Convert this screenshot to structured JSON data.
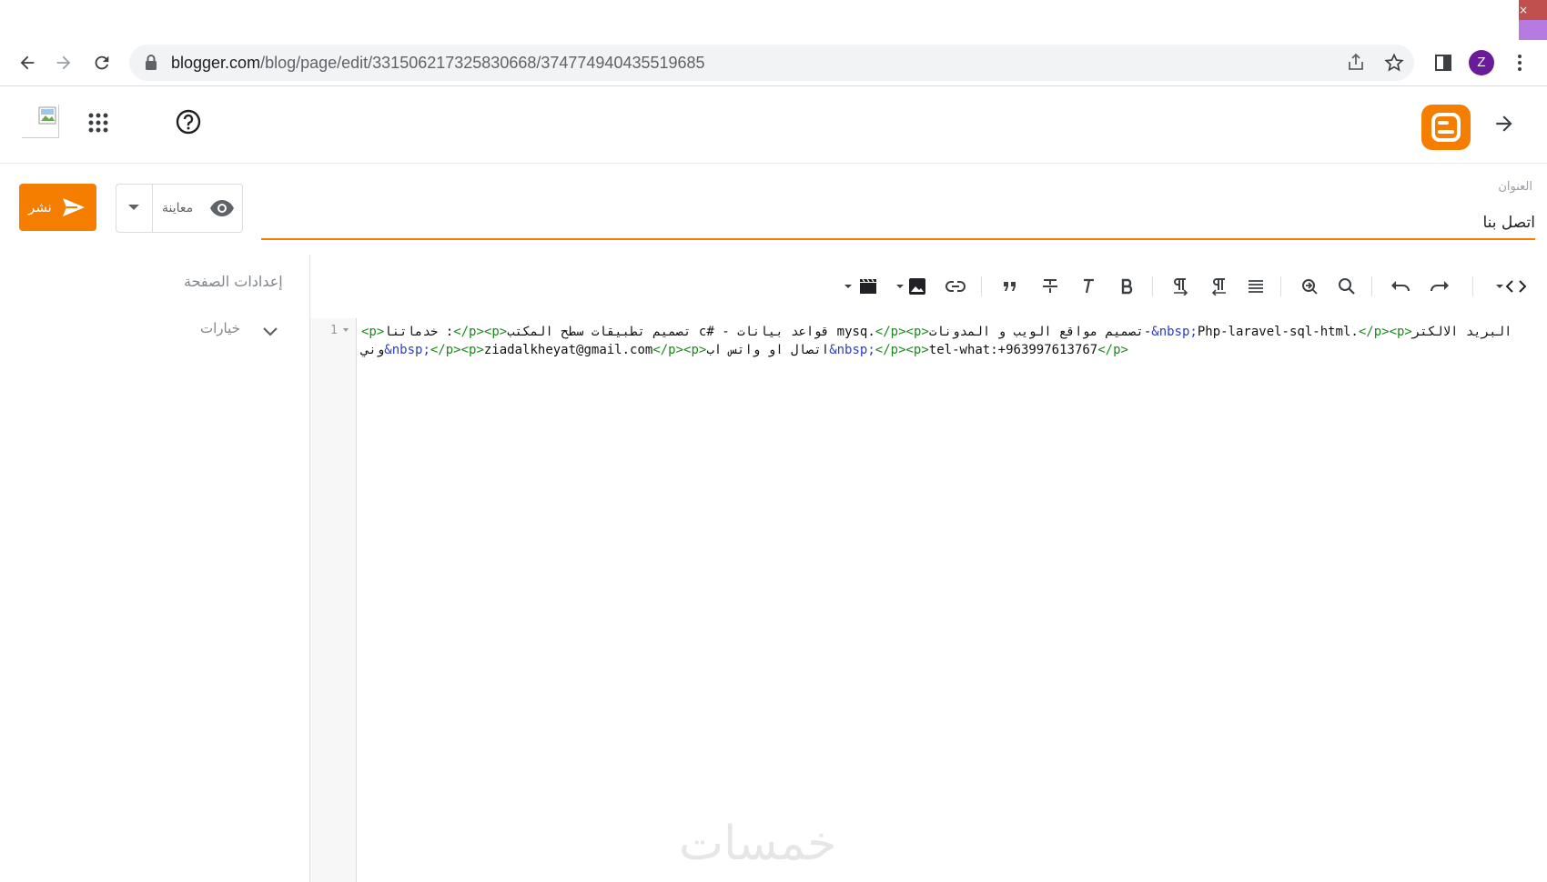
{
  "browser": {
    "url_host": "blogger.com",
    "url_path": "/blog/page/edit/3315062173258306​68/374774940435519685",
    "avatar_letter": "Z"
  },
  "editor": {
    "title_label": "العنوان",
    "title_value": "اتصل بنا",
    "publish_label": "نشر",
    "preview_label": "معاينة"
  },
  "sidebar": {
    "page_settings_title": "إعدادات الصفحة",
    "options_label": "خيارات"
  },
  "code": {
    "line_number": "1",
    "tokens": [
      {
        "t": "<p>",
        "k": "tag"
      },
      {
        "t": "خدماتنا :",
        "k": "text"
      },
      {
        "t": "</p><p>",
        "k": "tag"
      },
      {
        "t": "تصميم تطبيقات سطح المكتب c# - قواعد بيانات mysq.",
        "k": "text"
      },
      {
        "t": "</p><p>",
        "k": "tag"
      },
      {
        "t": "تصميم مواقع الويب و المدونات-",
        "k": "text"
      },
      {
        "t": "&nbsp;",
        "k": "ent"
      },
      {
        "t": "Php-laravel-sql-html.",
        "k": "text"
      },
      {
        "t": "</p><p>",
        "k": "tag"
      },
      {
        "t": "البريد الالكتروني",
        "k": "text"
      },
      {
        "t": "&nbsp;",
        "k": "ent"
      },
      {
        "t": "</p><p>",
        "k": "tag"
      },
      {
        "t": "ziadalkheyat@gmail.com",
        "k": "text"
      },
      {
        "t": "</p><p>",
        "k": "tag"
      },
      {
        "t": "اتصال او واتس اب",
        "k": "text"
      },
      {
        "t": "&nbsp;",
        "k": "ent"
      },
      {
        "t": "</p><p>",
        "k": "tag"
      },
      {
        "t": "tel-what:+963997613767",
        "k": "text"
      },
      {
        "t": "</p>",
        "k": "tag"
      }
    ]
  },
  "watermark": "خمسات",
  "colors": {
    "accent": "#f57d00",
    "tag": "#1a8a1a",
    "entity": "#2a3fbf",
    "avatar": "#6a1b9a"
  },
  "icons": [
    "back-arrow-icon",
    "forward-arrow-icon",
    "reload-icon",
    "lock-icon",
    "share-icon",
    "star-icon",
    "side-panel-icon",
    "kebab-menu-icon",
    "apps-grid-icon",
    "help-icon",
    "blogger-logo-icon",
    "send-icon",
    "eye-icon",
    "chevron-down-icon",
    "code-view-icon",
    "undo-icon",
    "redo-icon",
    "search-icon",
    "find-replace-icon",
    "align-icon",
    "rtl-icon",
    "ltr-icon",
    "bold-icon",
    "format-clear-icon",
    "strikethrough-icon",
    "quote-icon",
    "link-icon",
    "image-icon",
    "video-icon"
  ]
}
